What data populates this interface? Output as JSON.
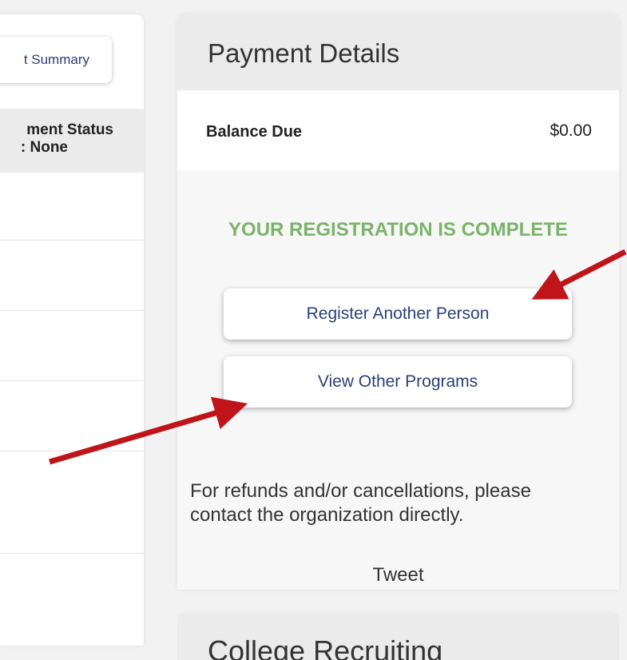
{
  "left": {
    "summary_button": "t Summary",
    "status_line1": "ment Status",
    "status_line2": ": None"
  },
  "payment": {
    "title": "Payment Details",
    "balance_label": "Balance Due",
    "balance_value": "$0.00",
    "complete_message": "YOUR REGISTRATION IS COMPLETE",
    "register_button": "Register Another Person",
    "programs_button": "View Other Programs",
    "refund_line1": "For refunds and/or cancellations, please",
    "refund_line2": "contact the organization directly.",
    "tweet": "Tweet"
  },
  "bottom": {
    "title": "College Recruiting"
  },
  "colors": {
    "accent_green": "#7ab36a",
    "button_text": "#2a3f7a",
    "arrow": "#c0141b"
  }
}
